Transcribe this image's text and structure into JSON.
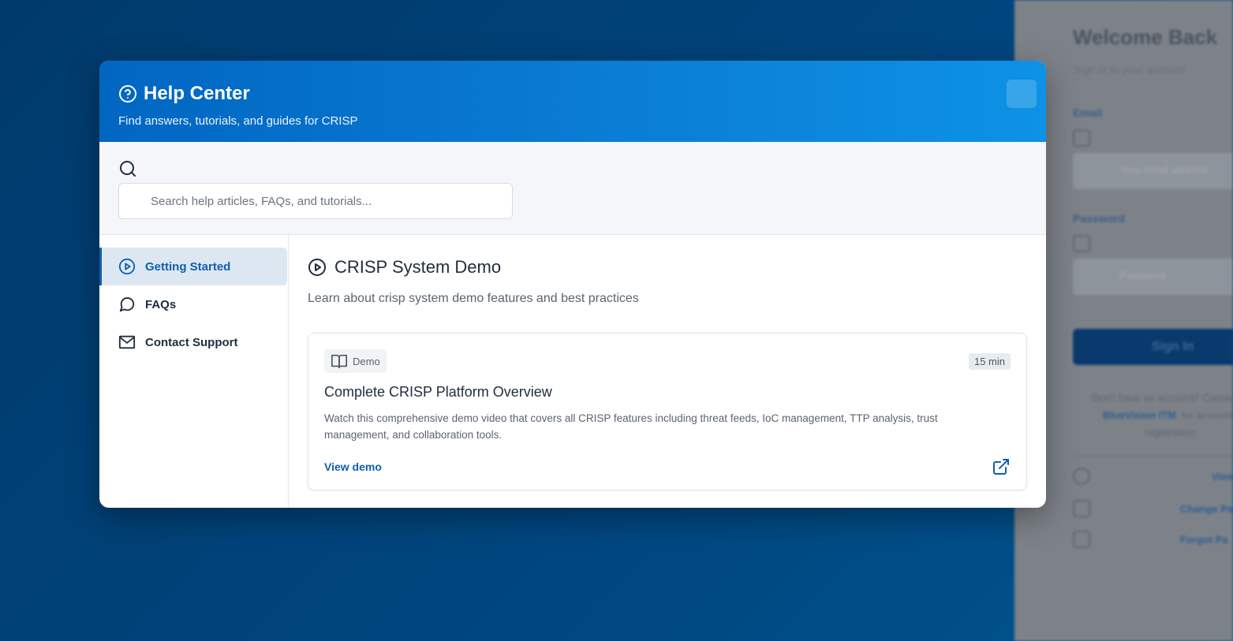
{
  "background_login": {
    "title": "Welcome Back",
    "subtitle": "Sign in to your account",
    "email_label": "Email",
    "email_placeholder": "Your email address",
    "password_label": "Password",
    "password_placeholder": "Password",
    "sign_in_label": "Sign In",
    "no_account_text": "Don't have an account? Contact",
    "no_account_link": "BlueVision ITM",
    "no_account_text2": "for account",
    "no_account_text3": "registration.",
    "view_label": "View",
    "change_password_label": "Change Pa",
    "forgot_password_label": "Forgot Pa"
  },
  "modal": {
    "title": "Help Center",
    "subtitle": "Find answers, tutorials, and guides for CRISP"
  },
  "search": {
    "placeholder": "Search help articles, FAQs, and tutorials..."
  },
  "sidebar": {
    "items": [
      {
        "label": "Getting Started",
        "icon": "play-circle-icon",
        "active": true
      },
      {
        "label": "FAQs",
        "icon": "chat-bubble-icon",
        "active": false
      },
      {
        "label": "Contact Support",
        "icon": "envelope-icon",
        "active": false
      }
    ]
  },
  "section": {
    "title": "CRISP System Demo",
    "description": "Learn about crisp system demo features and best practices"
  },
  "card": {
    "tag": "Demo",
    "duration": "15 min",
    "title": "Complete CRISP Platform Overview",
    "description": "Watch this comprehensive demo video that covers all CRISP features including threat feeds, IoC management, TTP analysis, trust management, and collaboration tools.",
    "link_label": "View demo"
  },
  "colors": {
    "header_start": "#0066c2",
    "header_end": "#0d92e6",
    "accent": "#0f5fae",
    "active_bg": "#dde7f2"
  }
}
